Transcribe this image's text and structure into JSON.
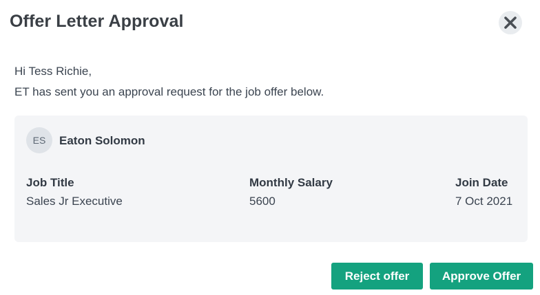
{
  "dialog": {
    "title": "Offer Letter Approval",
    "close_icon": "close-icon"
  },
  "greeting": "Hi Tess Richie,",
  "message": "ET has sent you an approval request for the job offer below.",
  "offer": {
    "candidate": {
      "initials": "ES",
      "name": "Eaton Solomon"
    },
    "fields": [
      {
        "label": "Job Title",
        "value": "Sales Jr Executive"
      },
      {
        "label": "Monthly Salary",
        "value": "5600"
      },
      {
        "label": "Join Date",
        "value": "7 Oct 2021"
      }
    ]
  },
  "actions": {
    "reject_label": "Reject offer",
    "approve_label": "Approve Offer"
  },
  "colors": {
    "accent": "#14a27f",
    "card_background": "#f4f5f7",
    "close_button_background": "#e9ecef"
  }
}
